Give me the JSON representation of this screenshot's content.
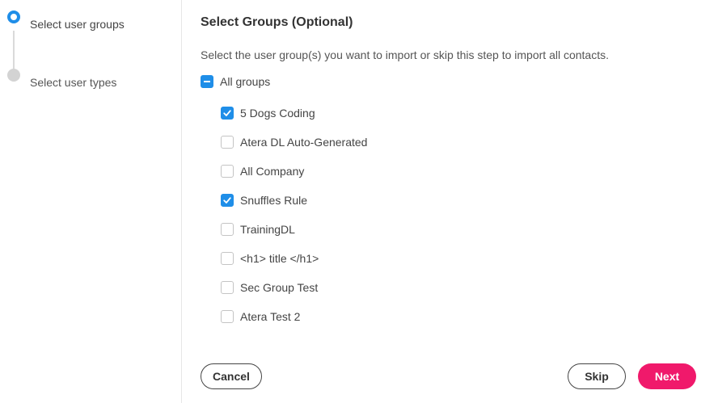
{
  "stepper": {
    "steps": [
      {
        "label": "Select user groups",
        "state": "active"
      },
      {
        "label": "Select user types",
        "state": "inactive"
      }
    ]
  },
  "main": {
    "title": "Select Groups (Optional)",
    "description": "Select the user group(s) you want to import or skip this step to import all contacts.",
    "all_groups": {
      "label": "All groups",
      "state": "indeterminate"
    },
    "groups": [
      {
        "label": "5 Dogs Coding",
        "checked": true
      },
      {
        "label": "Atera DL Auto-Generated",
        "checked": false
      },
      {
        "label": "All Company",
        "checked": false
      },
      {
        "label": "Snuffles Rule",
        "checked": true
      },
      {
        "label": "TrainingDL",
        "checked": false
      },
      {
        "label": "<h1> title </h1>",
        "checked": false
      },
      {
        "label": "Sec Group Test",
        "checked": false
      },
      {
        "label": "Atera Test 2",
        "checked": false
      }
    ]
  },
  "buttons": {
    "cancel": "Cancel",
    "skip": "Skip",
    "next": "Next"
  },
  "colors": {
    "accent": "#1f8ee8",
    "primary_button": "#f0196b"
  }
}
